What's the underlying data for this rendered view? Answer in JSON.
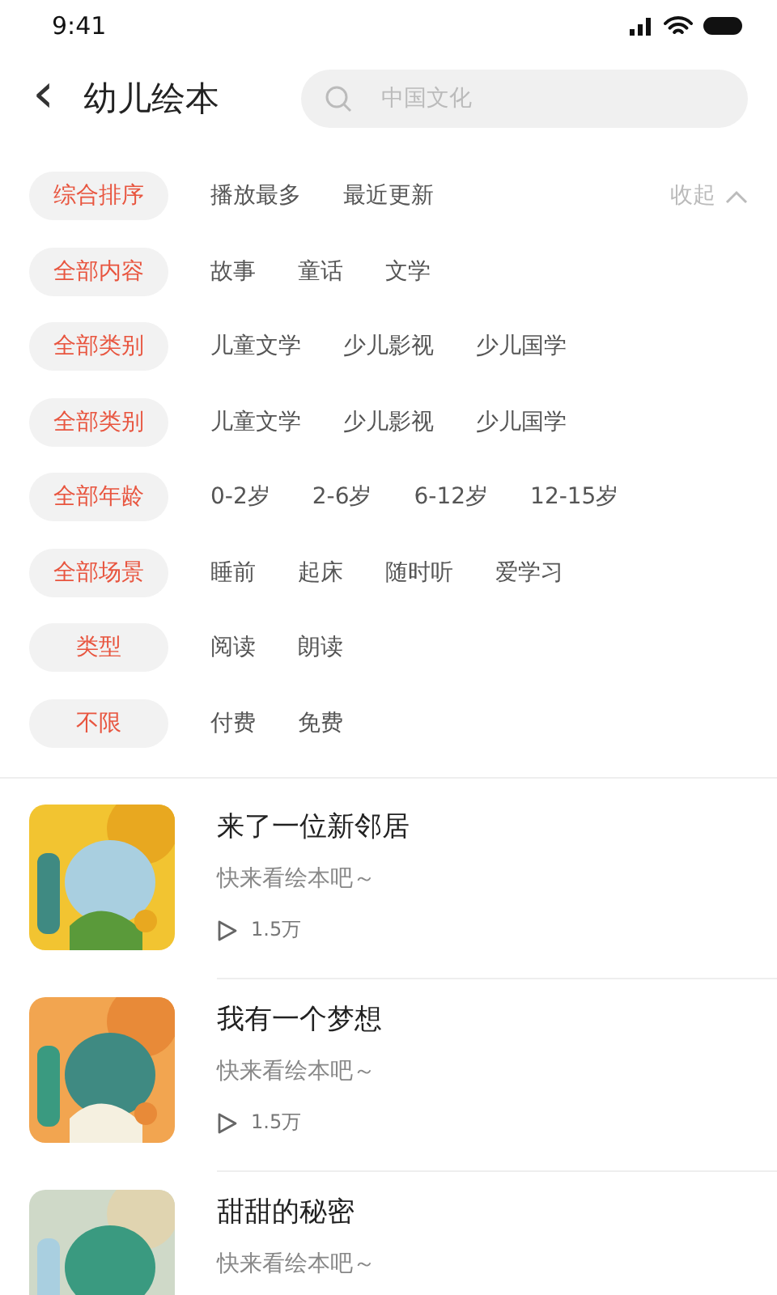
{
  "status_bar": {
    "time": "9:41"
  },
  "header": {
    "back": "‹",
    "title": "幼儿绘本",
    "search": {
      "placeholder": "中国文化"
    }
  },
  "filters": [
    {
      "options": [
        {
          "label": "综合排序",
          "selected": true
        },
        {
          "label": "播放最多",
          "selected": false
        },
        {
          "label": "最近更新",
          "selected": false
        }
      ]
    },
    {
      "options": [
        {
          "label": "全部内容",
          "selected": true
        },
        {
          "label": "故事",
          "selected": false
        },
        {
          "label": "童话",
          "selected": false
        },
        {
          "label": "文学",
          "selected": false
        }
      ]
    },
    {
      "options": [
        {
          "label": "全部类别",
          "selected": true
        },
        {
          "label": "儿童文学",
          "selected": false
        },
        {
          "label": "少儿影视",
          "selected": false
        },
        {
          "label": "少儿国学",
          "selected": false
        }
      ]
    },
    {
      "options": [
        {
          "label": "全部类别",
          "selected": true
        },
        {
          "label": "儿童文学",
          "selected": false
        },
        {
          "label": "少儿影视",
          "selected": false
        },
        {
          "label": "少儿国学",
          "selected": false
        }
      ]
    },
    {
      "options": [
        {
          "label": "全部年龄",
          "selected": true
        },
        {
          "label": "0-2岁",
          "selected": false
        },
        {
          "label": "2-6岁",
          "selected": false
        },
        {
          "label": "6-12岁",
          "selected": false
        },
        {
          "label": "12-15岁",
          "selected": false
        }
      ]
    },
    {
      "options": [
        {
          "label": "全部场景",
          "selected": true
        },
        {
          "label": "睡前",
          "selected": false
        },
        {
          "label": "起床",
          "selected": false
        },
        {
          "label": "随时听",
          "selected": false
        },
        {
          "label": "爱学习",
          "selected": false
        }
      ]
    },
    {
      "options": [
        {
          "label": "类型",
          "selected": true
        },
        {
          "label": "阅读",
          "selected": false
        },
        {
          "label": "朗读",
          "selected": false
        }
      ]
    },
    {
      "options": [
        {
          "label": "不限",
          "selected": true
        },
        {
          "label": "付费",
          "selected": false
        },
        {
          "label": "免费",
          "selected": false
        }
      ]
    }
  ],
  "collapse": "收起",
  "books": [
    {
      "title": "来了一位新邻居",
      "subtitle": "快来看绘本吧～",
      "plays": "1.5万"
    },
    {
      "title": "我有一个梦想",
      "subtitle": "快来看绘本吧～",
      "plays": "1.5万"
    },
    {
      "title": "甜甜的秘密",
      "subtitle": "快来看绘本吧～"
    }
  ]
}
